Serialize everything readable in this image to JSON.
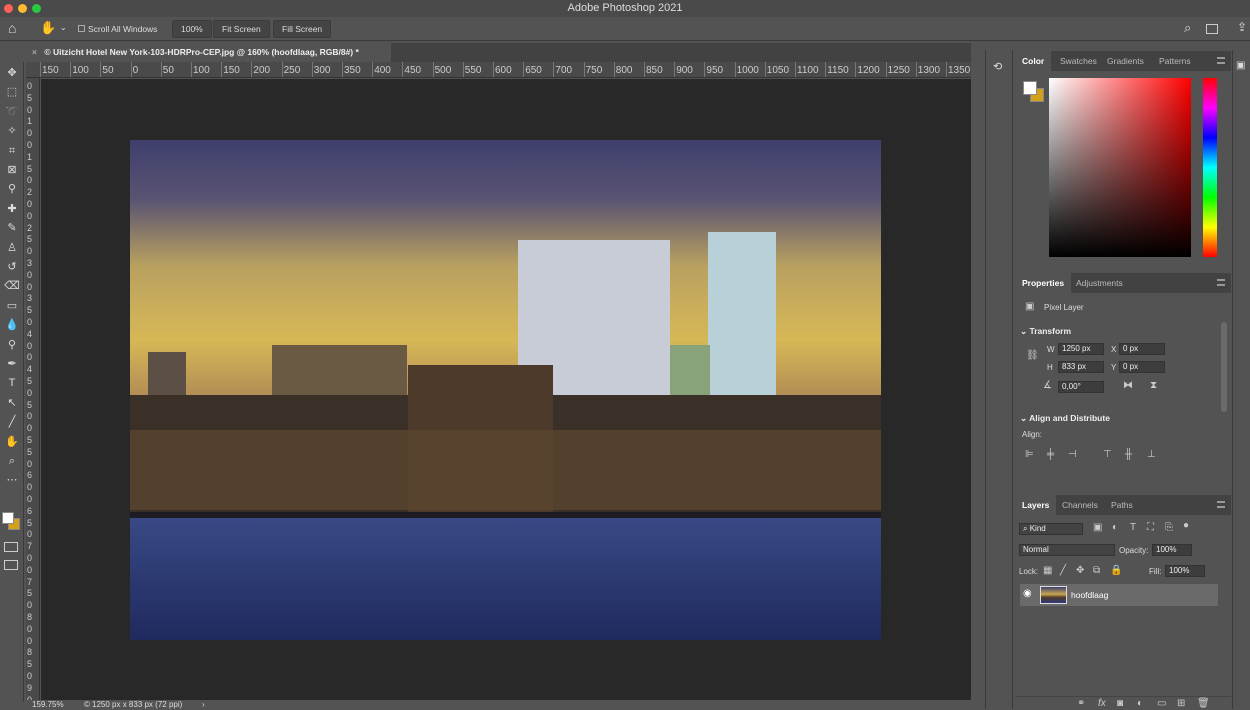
{
  "app_title": "Adobe Photoshop 2021",
  "options_bar": {
    "scroll_all_windows": "Scroll All Windows",
    "zoom_100": "100%",
    "fit_screen": "Fit Screen",
    "fill_screen": "Fill Screen"
  },
  "document_tab": {
    "title": "© Uitzicht Hotel New York-103-HDRPro-CEP.jpg @ 160% (hoofdlaag, RGB/8#) *",
    "close": "×"
  },
  "ruler_h": [
    "150",
    "100",
    "50",
    "0",
    "50",
    "100",
    "150",
    "200",
    "250",
    "300",
    "350",
    "400",
    "450",
    "500",
    "550",
    "600",
    "650",
    "700",
    "750",
    "800",
    "850",
    "900",
    "950",
    "1000",
    "1050",
    "1100",
    "1150",
    "1200",
    "1250",
    "1300",
    "1350"
  ],
  "ruler_v": [
    "0",
    "5",
    "0",
    "1",
    "0",
    "0",
    "1",
    "5",
    "0",
    "2",
    "0",
    "0",
    "2",
    "5",
    "0",
    "3",
    "0",
    "0",
    "3",
    "5",
    "0",
    "4",
    "0",
    "0",
    "4",
    "5",
    "0",
    "5",
    "0",
    "0",
    "5",
    "5",
    "0",
    "6",
    "0",
    "0",
    "6",
    "5",
    "0",
    "7",
    "0",
    "0",
    "7",
    "5",
    "0",
    "8",
    "0",
    "0",
    "8",
    "5",
    "0",
    "9",
    "0"
  ],
  "status": {
    "zoom": "159.75%",
    "doc_info": "1250 px x 833 px (72 ppi)",
    "arrow": "›"
  },
  "colors": {
    "foreground": "#ffffff",
    "background": "#d4a017"
  },
  "color_panel": {
    "tabs": [
      "Color",
      "Swatches",
      "Gradients",
      "Patterns"
    ]
  },
  "properties_panel": {
    "tabs": [
      "Properties",
      "Adjustments"
    ],
    "layer_type": "Pixel Layer",
    "transform": {
      "title": "Transform",
      "w_label": "W",
      "w": "1250 px",
      "h_label": "H",
      "h": "833 px",
      "x_label": "X",
      "x": "0 px",
      "y_label": "Y",
      "y": "0 px",
      "angle": "0,00°"
    },
    "align": {
      "title": "Align and Distribute",
      "label": "Align:"
    }
  },
  "layers_panel": {
    "tabs": [
      "Layers",
      "Channels",
      "Paths"
    ],
    "filter": "Kind",
    "blend_mode": "Normal",
    "opacity_label": "Opacity:",
    "opacity": "100%",
    "lock_label": "Lock:",
    "fill_label": "Fill:",
    "fill": "100%",
    "layers": [
      {
        "name": "hoofdlaag",
        "visible": true
      }
    ]
  },
  "icons": {
    "fx": "fx"
  }
}
